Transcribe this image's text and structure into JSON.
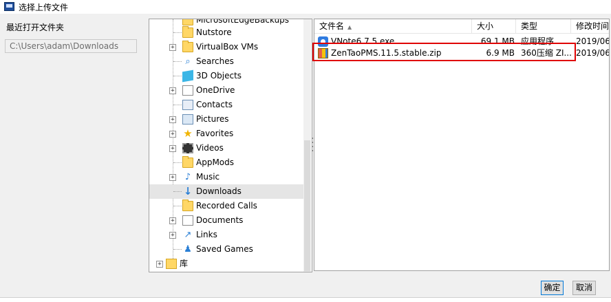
{
  "window": {
    "title": "选择上传文件"
  },
  "recent": {
    "label": "最近打开文件夹",
    "path": "C:\\Users\\adam\\Downloads"
  },
  "tree": {
    "partial_label": "MicrosoftEdgeBackups",
    "items": [
      {
        "label": "Nutstore",
        "icon": "folder-icon",
        "expander": ""
      },
      {
        "label": "VirtualBox VMs",
        "icon": "folder-icon",
        "expander": "+"
      },
      {
        "label": "Searches",
        "icon": "search-icon",
        "expander": ""
      },
      {
        "label": "3D Objects",
        "icon": "3d-objects-icon",
        "expander": ""
      },
      {
        "label": "OneDrive",
        "icon": "onedrive-icon",
        "expander": "+"
      },
      {
        "label": "Contacts",
        "icon": "contacts-icon",
        "expander": ""
      },
      {
        "label": "Pictures",
        "icon": "pictures-icon",
        "expander": "+"
      },
      {
        "label": "Favorites",
        "icon": "star-icon",
        "expander": "+"
      },
      {
        "label": "Videos",
        "icon": "videos-icon",
        "expander": "+"
      },
      {
        "label": "AppMods",
        "icon": "folder-icon",
        "expander": ""
      },
      {
        "label": "Music",
        "icon": "music-icon",
        "expander": "+"
      },
      {
        "label": "Downloads",
        "icon": "download-icon",
        "expander": "",
        "selected": true
      },
      {
        "label": "Recorded Calls",
        "icon": "folder-icon",
        "expander": ""
      },
      {
        "label": "Documents",
        "icon": "documents-icon",
        "expander": "+"
      },
      {
        "label": "Links",
        "icon": "links-icon",
        "expander": "+"
      },
      {
        "label": "Saved Games",
        "icon": "saved-games-icon",
        "expander": ""
      }
    ],
    "library": {
      "label": "库",
      "icon": "library-icon",
      "expander": "+"
    }
  },
  "files": {
    "columns": {
      "name": "文件名",
      "size": "大小",
      "type": "类型",
      "date": "修改时间"
    },
    "rows": [
      {
        "name": "VNote6.7.5.exe",
        "size": "69.1 MB",
        "type": "应用程序",
        "date": "2019/06",
        "icon": "exe-icon"
      },
      {
        "name": "ZenTaoPMS.11.5.stable.zip",
        "size": "6.9 MB",
        "type": "360压缩 ZI...",
        "date": "2019/06",
        "icon": "zip-icon"
      }
    ]
  },
  "buttons": {
    "ok": "确定",
    "cancel": "取消"
  },
  "colors": {
    "highlight": "#e00000",
    "selection": "#e5e5e5",
    "accent": "#0078d7"
  }
}
